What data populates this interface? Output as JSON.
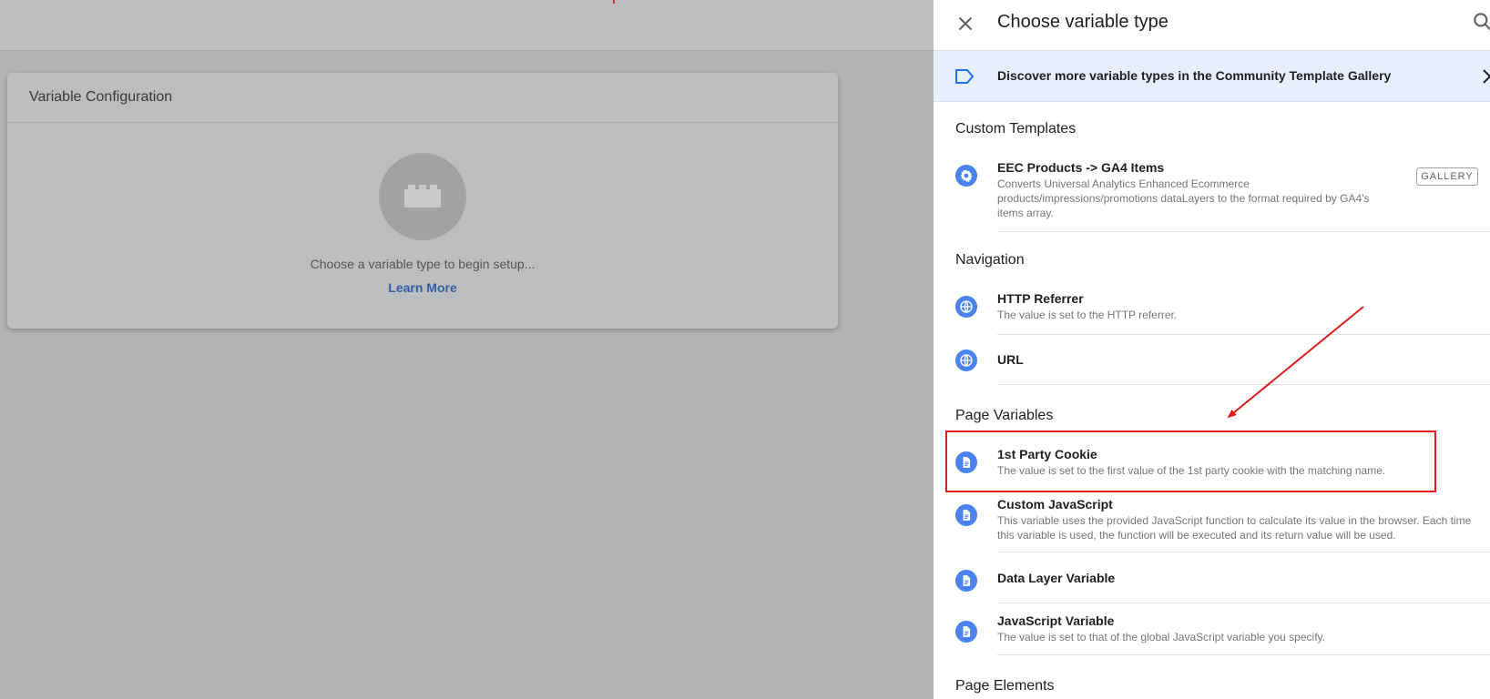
{
  "background": {
    "card": {
      "title": "Variable Configuration",
      "hint": "Choose a variable type to begin setup...",
      "learn_more": "Learn More"
    }
  },
  "panel": {
    "title": "Choose variable type",
    "discover": "Discover more variable types in the Community Template Gallery",
    "sections": {
      "custom_templates": "Custom Templates",
      "navigation": "Navigation",
      "page_variables": "Page Variables",
      "page_elements": "Page Elements"
    },
    "items": {
      "eec": {
        "name": "EEC Products -> GA4 Items",
        "desc": "Converts Universal Analytics Enhanced Ecommerce products/impressions/promotions dataLayers to the format required by GA4's items array.",
        "badge": "GALLERY",
        "icon": "gear-icon"
      },
      "http_referrer": {
        "name": "HTTP Referrer",
        "desc": "The value is set to the HTTP referrer.",
        "icon": "globe-icon"
      },
      "url": {
        "name": "URL",
        "icon": "globe-icon"
      },
      "first_party_cookie": {
        "name": "1st Party Cookie",
        "desc": "The value is set to the first value of the 1st party cookie with the matching name.",
        "icon": "document-icon"
      },
      "custom_js": {
        "name": "Custom JavaScript",
        "desc": "This variable uses the provided JavaScript function to calculate its value in the browser. Each time this variable is used, the function will be executed and its return value will be used.",
        "icon": "document-icon"
      },
      "data_layer": {
        "name": "Data Layer Variable",
        "icon": "document-icon"
      },
      "js_variable": {
        "name": "JavaScript Variable",
        "desc": "The value is set to that of the global JavaScript variable you specify.",
        "icon": "document-icon"
      }
    }
  },
  "colors": {
    "accent_blue": "#4a83ec",
    "annotation_red": "#e01b1b",
    "discover_bg": "#e8eefb"
  }
}
